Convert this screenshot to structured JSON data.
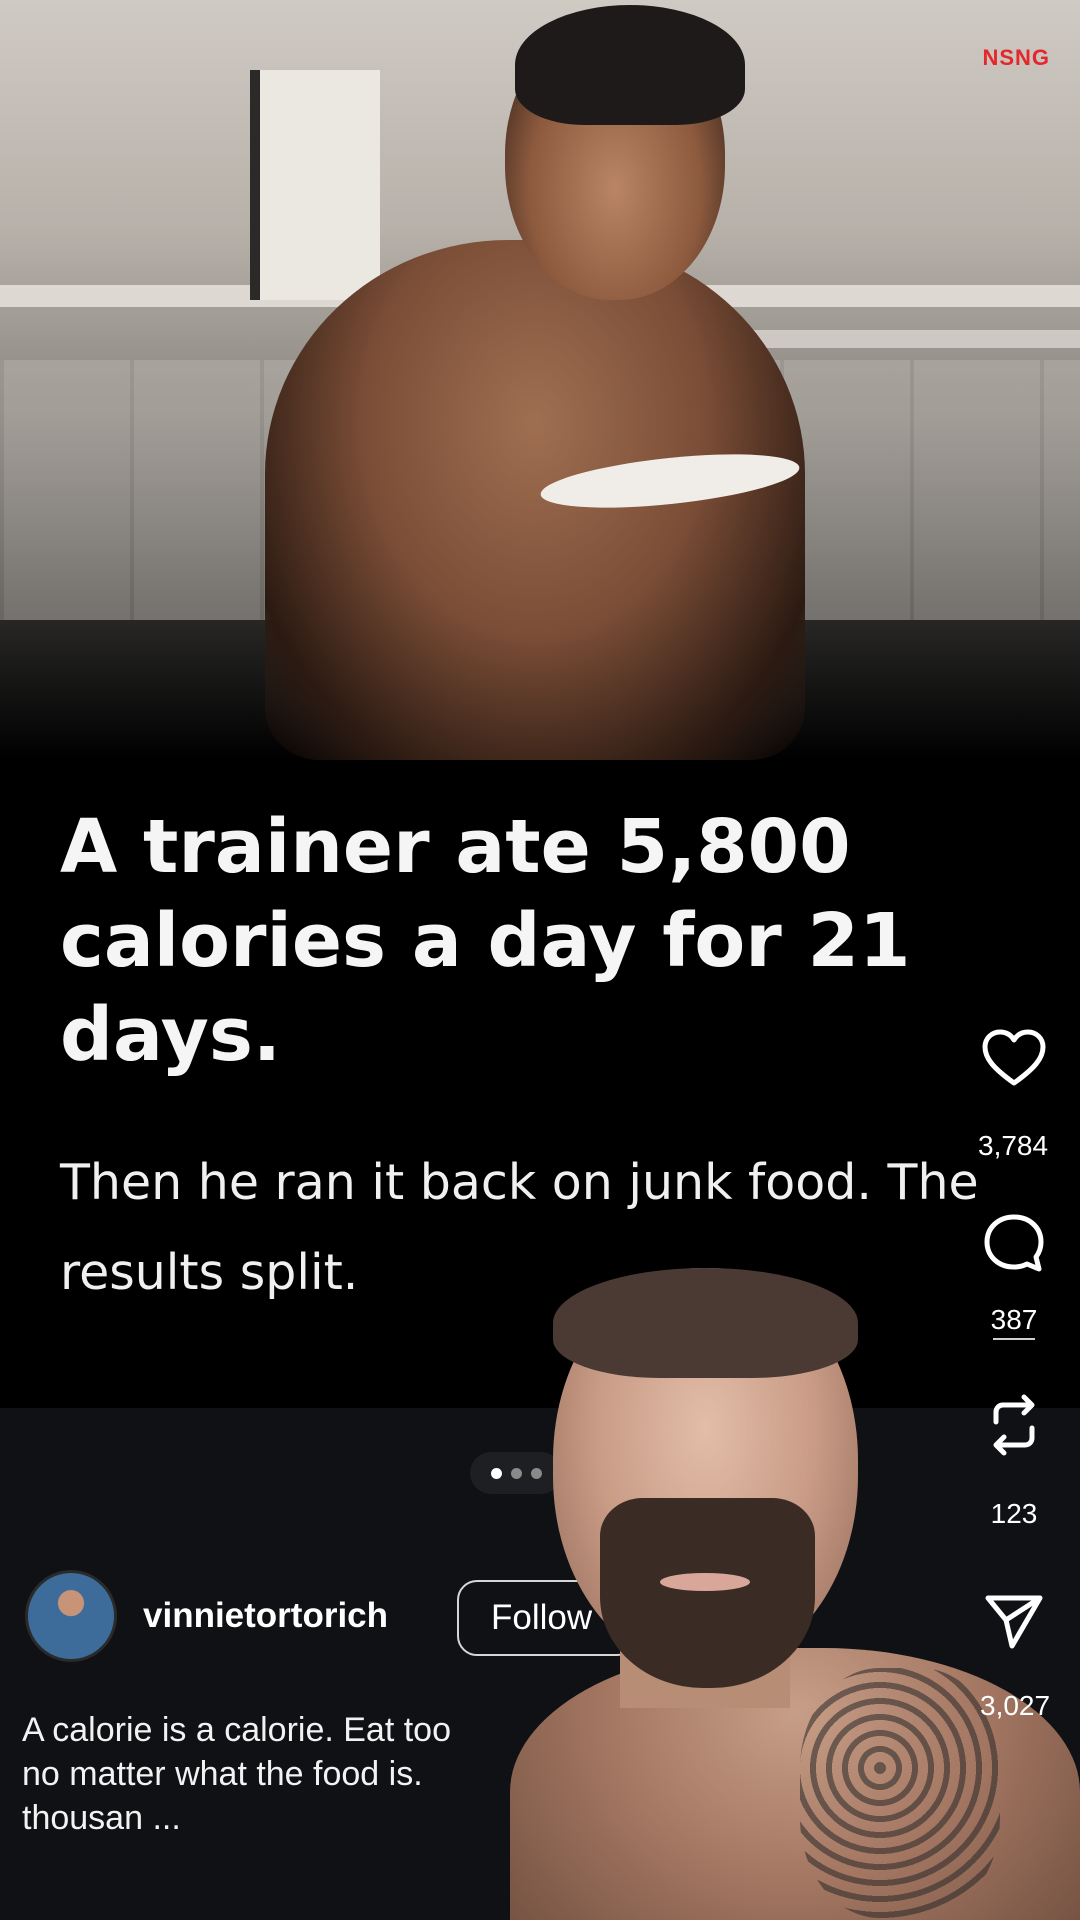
{
  "post": {
    "image_watermark": "NSNG",
    "headline": "A trainer ate 5,800 calories a day for 21 days.",
    "subline": "Then he ran it back on junk food. The results split."
  },
  "carousel": {
    "dots": 3,
    "active_index": 0
  },
  "author": {
    "username": "vinnietortorich",
    "follow_label": "Follow"
  },
  "caption": {
    "text": "A calorie is a calorie. Eat too",
    "line2": "no matter what the food is.",
    "line3": "thousan",
    "more": "..."
  },
  "actions": {
    "like_count": "3,784",
    "comment_count": "387",
    "repost_count": "123",
    "share_count": "3,027"
  },
  "icons": {
    "like": "heart-icon",
    "comment": "comment-bubble-icon",
    "repost": "repost-icon",
    "share": "send-icon"
  }
}
